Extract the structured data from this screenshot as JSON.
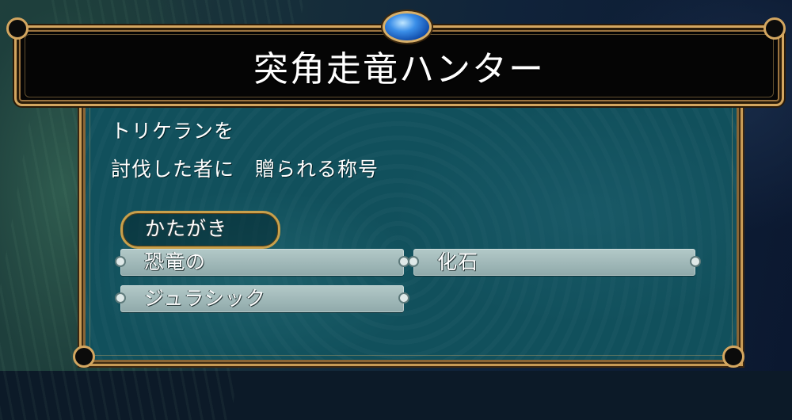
{
  "title": "突角走竜ハンター",
  "description": {
    "line1": "トリケランを",
    "line2": "討伐した者に　贈られる称号"
  },
  "selected_word": "かたがき",
  "words": [
    {
      "label": "恐竜の"
    },
    {
      "label": "化石"
    },
    {
      "label": "ジュラシック"
    }
  ],
  "colors": {
    "frame_gold": "#d3a660",
    "panel_teal": "#11505c",
    "gem_blue": "#3a8ee8"
  }
}
